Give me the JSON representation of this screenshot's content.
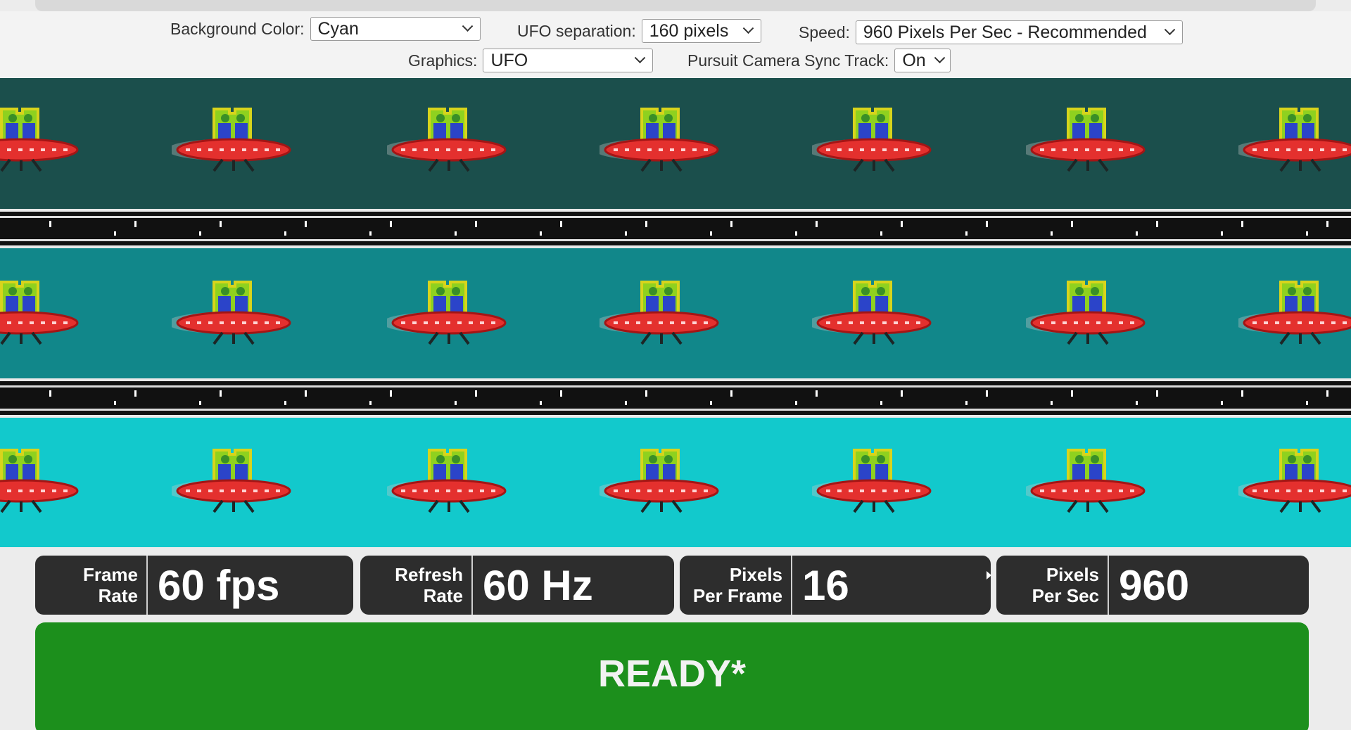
{
  "controls": {
    "background_color": {
      "label": "Background Color:",
      "value": "Cyan"
    },
    "ufo_separation": {
      "label": "UFO separation:",
      "value": "160 pixels"
    },
    "speed": {
      "label": "Speed:",
      "value": "960 Pixels Per Sec - Recommended"
    },
    "graphics": {
      "label": "Graphics:",
      "value": "UFO"
    },
    "pursuit_sync": {
      "label": "Pursuit Camera Sync Track:",
      "value": "On"
    }
  },
  "bands": [
    {
      "color": "#1b4f4c"
    },
    {
      "color": "#11878a"
    },
    {
      "color": "#12c9cc"
    }
  ],
  "stats": {
    "frame_rate": {
      "label": "Frame\nRate",
      "value": "60 fps"
    },
    "refresh_rate": {
      "label": "Refresh\nRate",
      "value": "60 Hz"
    },
    "pixels_per_frame": {
      "label": "Pixels\nPer Frame",
      "value": "16"
    },
    "pixels_per_sec": {
      "label": "Pixels\nPer Sec",
      "value": "960"
    }
  },
  "status": {
    "text": "READY*",
    "color": "#1c8f1c"
  },
  "icons": [
    "ufo-icon",
    "chevron-down-icon"
  ]
}
